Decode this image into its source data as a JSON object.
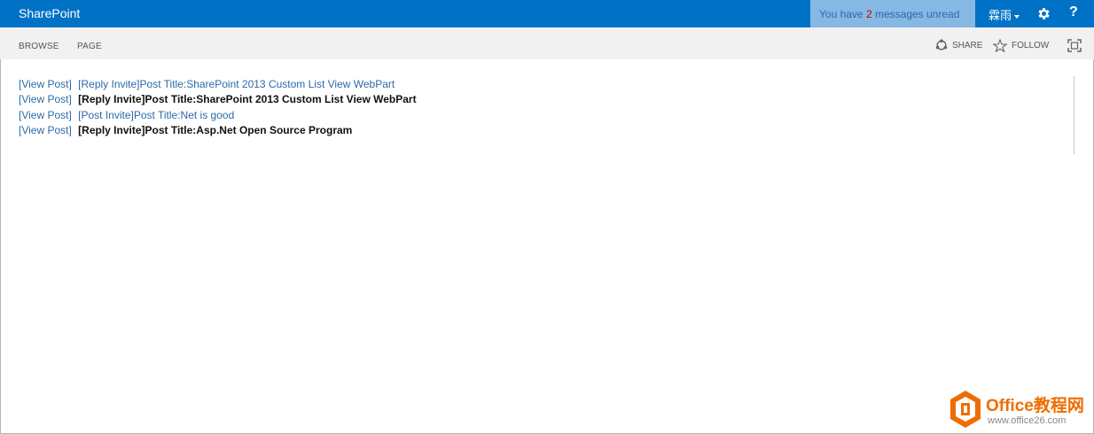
{
  "suite_bar": {
    "brand": "SharePoint",
    "messages": {
      "prefix": "You have ",
      "count": "2",
      "suffix": " messages unread"
    },
    "user_name": "霖雨",
    "help_label": "?",
    "colors": {
      "bar": "#0072c6",
      "message_box": "#86b8e4"
    }
  },
  "ribbon": {
    "tabs": [
      {
        "label": "BROWSE"
      },
      {
        "label": "PAGE"
      }
    ],
    "share_label": "SHARE",
    "follow_label": "FOLLOW"
  },
  "posts": [
    {
      "view_label": "[View Post]",
      "title": "[Reply Invite]Post Title:SharePoint 2013 Custom List View WebPart",
      "unread": false
    },
    {
      "view_label": "[View Post]",
      "title": "[Reply Invite]Post Title:SharePoint 2013 Custom List View WebPart",
      "unread": true
    },
    {
      "view_label": "[View Post]",
      "title": "[Post Invite]Post Title:Net is good",
      "unread": false
    },
    {
      "view_label": "[View Post]",
      "title": "[Reply Invite]Post Title:Asp.Net Open Source Program",
      "unread": true
    }
  ],
  "watermark": {
    "name": "Office教程网",
    "url": "www.office26.com",
    "icon": "office-logo-icon"
  }
}
